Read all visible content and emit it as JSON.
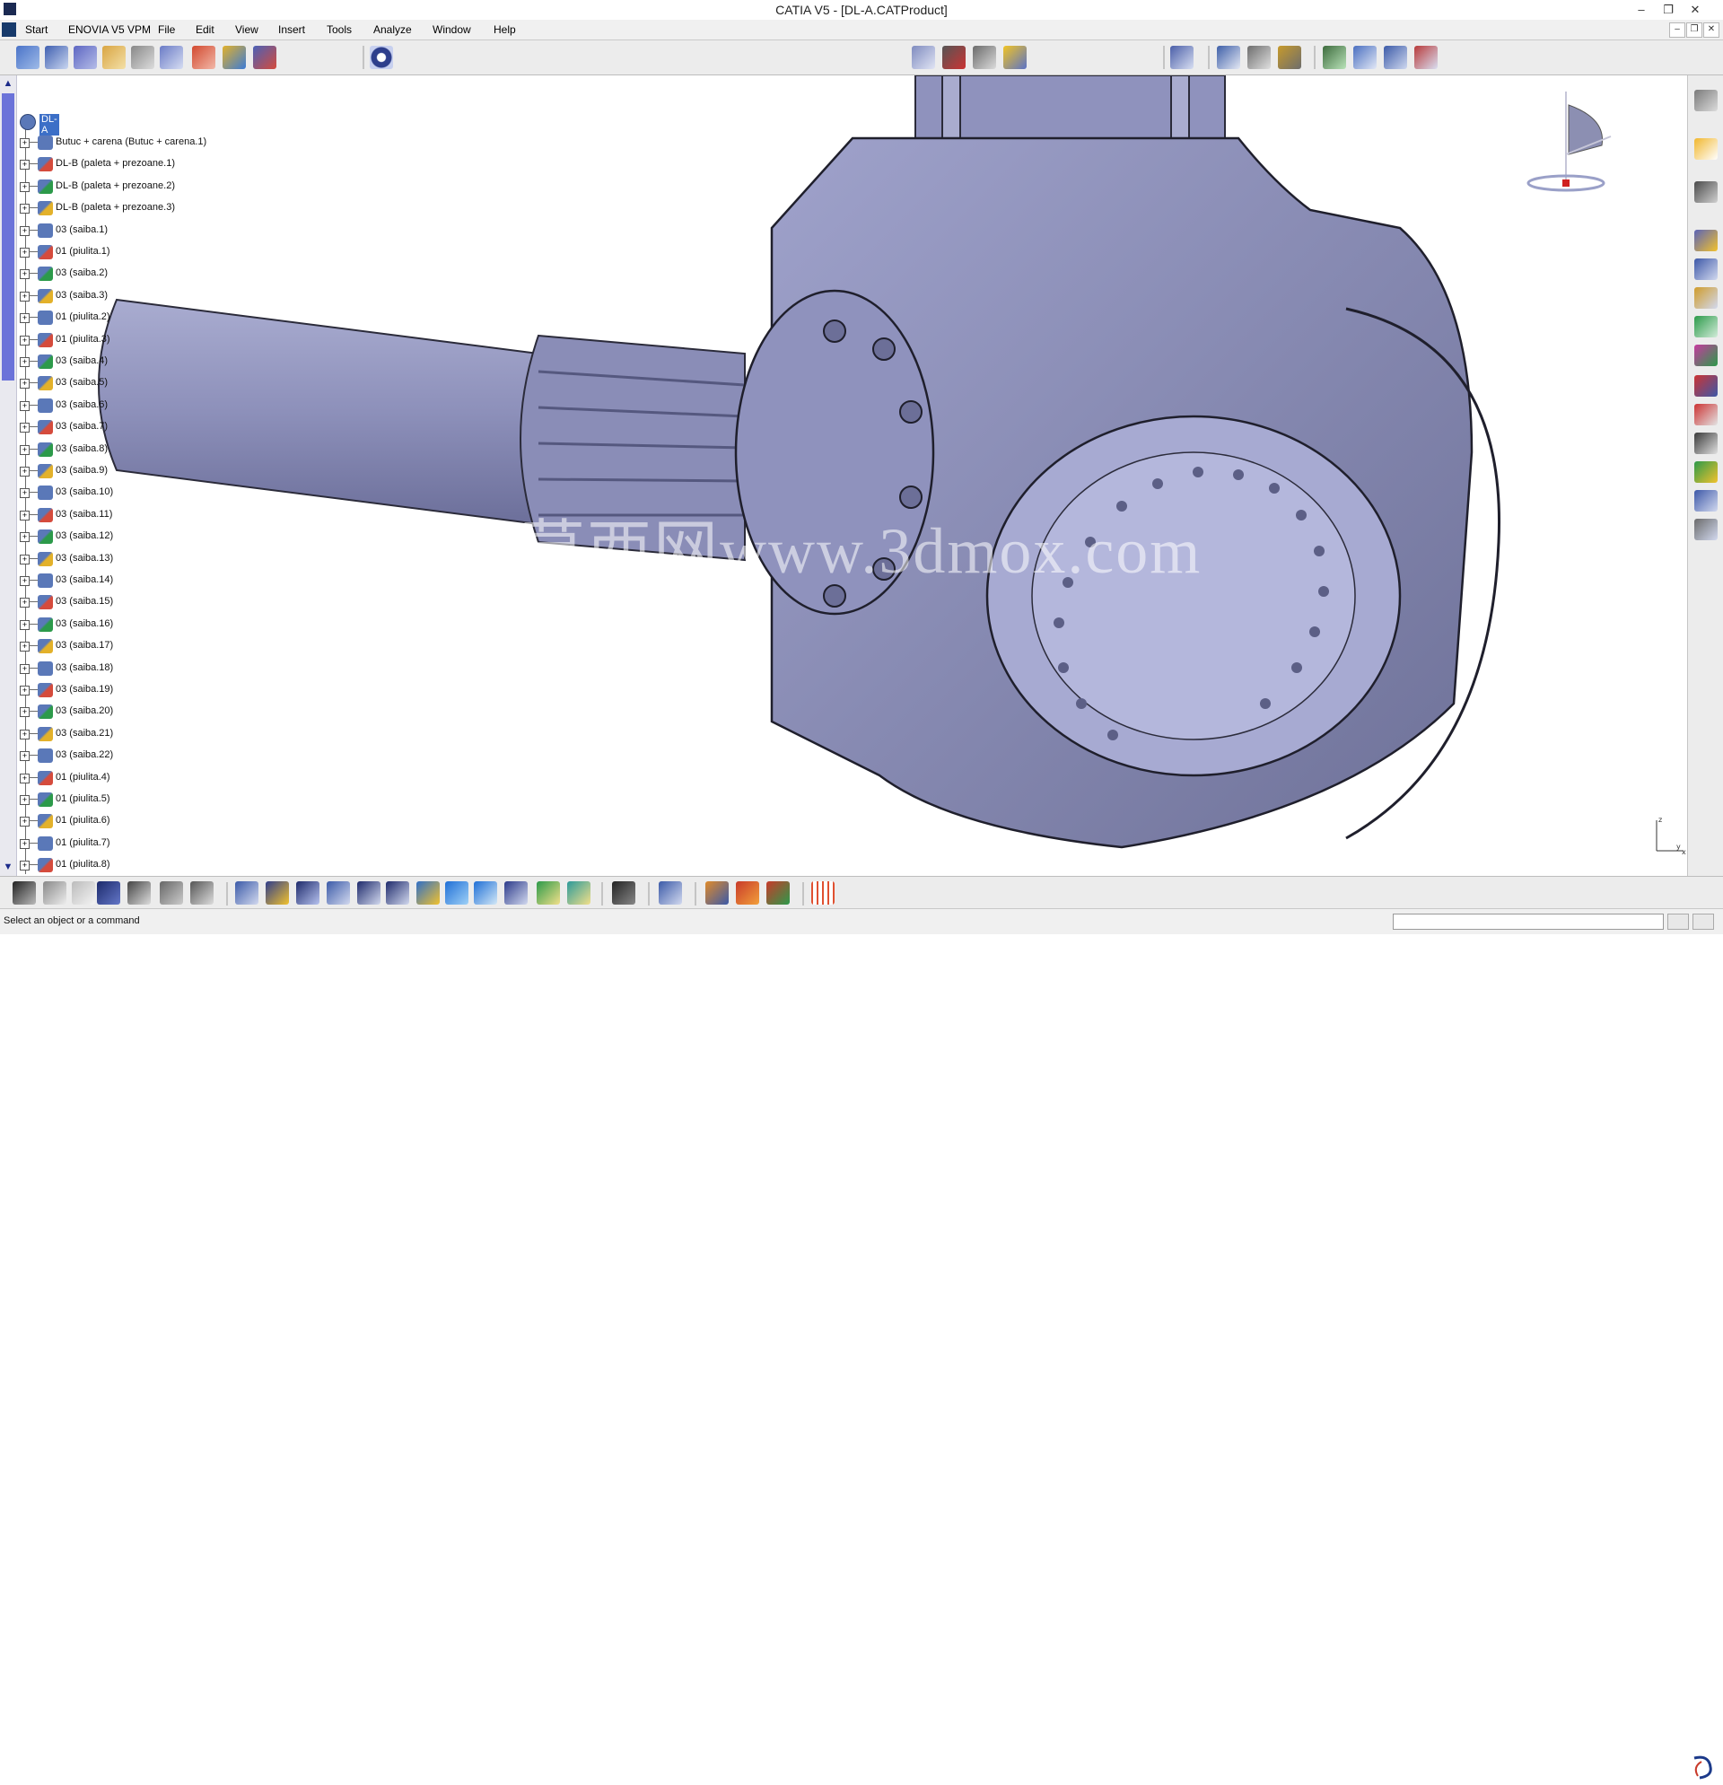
{
  "window": {
    "title": "CATIA V5 - [DL-A.CATProduct]",
    "controls": [
      "–",
      "❐",
      "✕"
    ]
  },
  "menubar": {
    "items": [
      "Start",
      "ENOVIA V5 VPM",
      "File",
      "Edit",
      "View",
      "Insert",
      "Tools",
      "Analyze",
      "Window",
      "Help"
    ],
    "mdi_controls": [
      "–",
      "❐",
      "✕"
    ]
  },
  "tree": {
    "root": "DL-A",
    "items": [
      "Butuc + carena (Butuc + carena.1)",
      "DL-B (paleta + prezoane.1)",
      "DL-B (paleta + prezoane.2)",
      "DL-B (paleta + prezoane.3)",
      "03 (saiba.1)",
      "01 (piulita.1)",
      "03 (saiba.2)",
      "03 (saiba.3)",
      "01 (piulita.2)",
      "01 (piulita.3)",
      "03 (saiba.4)",
      "03 (saiba.5)",
      "03 (saiba.6)",
      "03 (saiba.7)",
      "03 (saiba.8)",
      "03 (saiba.9)",
      "03 (saiba.10)",
      "03 (saiba.11)",
      "03 (saiba.12)",
      "03 (saiba.13)",
      "03 (saiba.14)",
      "03 (saiba.15)",
      "03 (saiba.16)",
      "03 (saiba.17)",
      "03 (saiba.18)",
      "03 (saiba.19)",
      "03 (saiba.20)",
      "03 (saiba.21)",
      "03 (saiba.22)",
      "01 (piulita.4)",
      "01 (piulita.5)",
      "01 (piulita.6)",
      "01 (piulita.7)",
      "01 (piulita.8)"
    ]
  },
  "viewport": {
    "watermark": "莫西网www.3dmox.com",
    "model_color": "#8a8fb8"
  },
  "icons": {
    "top_left": [
      "assembly-icon",
      "product-icon",
      "component-icon",
      "move-icon",
      "sketch-icon",
      "catalog-icon",
      "links-icon",
      "refresh-icon",
      "constraints-icon",
      "scan-icon"
    ],
    "top_right": [
      "manipulate-icon",
      "explode-icon",
      "snap-icon",
      "smart-move-icon",
      "update-icon",
      "measure-icon",
      "section-icon",
      "weight-icon",
      "generate-bom-icon",
      "publish-icon",
      "reorder-icon",
      "properties-icon"
    ],
    "bottom": [
      "formula-icon",
      "comment-icon",
      "lock-icon",
      "table-icon",
      "sensor-icon",
      "apply-material-icon",
      "options-icon",
      "fly-mode-icon",
      "fit-all-icon",
      "pan-icon",
      "rotate-icon",
      "zoom-in-icon",
      "zoom-out-icon",
      "normal-view-icon",
      "multi-view-icon",
      "iso-view-icon",
      "render-style-icon",
      "hide-show-icon",
      "swap-space-icon",
      "capture-icon",
      "measure-item-icon",
      "analysis-icon",
      "clash-icon",
      "compare-icon",
      "grid-icon"
    ]
  },
  "status": {
    "message": "Select an object or a command"
  }
}
